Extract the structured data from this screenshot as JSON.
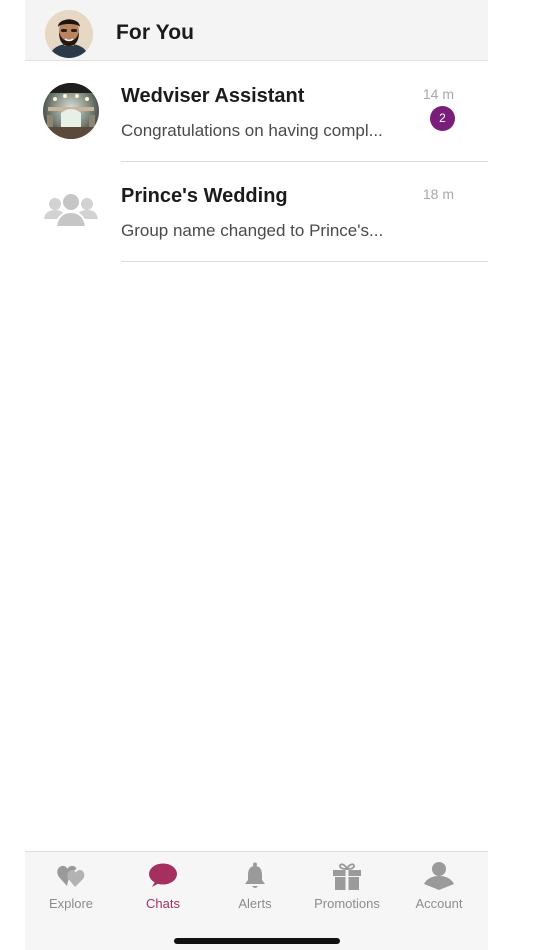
{
  "header": {
    "title": "For You"
  },
  "chats": [
    {
      "name": "Wedviser Assistant",
      "preview": "Congratulations on having compl...",
      "time": "14 m",
      "unread": "2",
      "avatar_icon": "venue-photo-icon"
    },
    {
      "name": "Prince's Wedding",
      "preview": "Group name changed to Prince's...",
      "time": "18 m",
      "avatar_icon": "group-icon"
    }
  ],
  "tabs": [
    {
      "label": "Explore",
      "icon": "hearts-icon",
      "active": false
    },
    {
      "label": "Chats",
      "icon": "chat-bubble-icon",
      "active": true
    },
    {
      "label": "Alerts",
      "icon": "bell-icon",
      "active": false
    },
    {
      "label": "Promotions",
      "icon": "gift-icon",
      "active": false
    },
    {
      "label": "Account",
      "icon": "user-icon",
      "active": false
    }
  ],
  "colors": {
    "accent": "#a5305f",
    "badge": "#7a1f79",
    "inactive_tab": "#8c8c8c"
  }
}
